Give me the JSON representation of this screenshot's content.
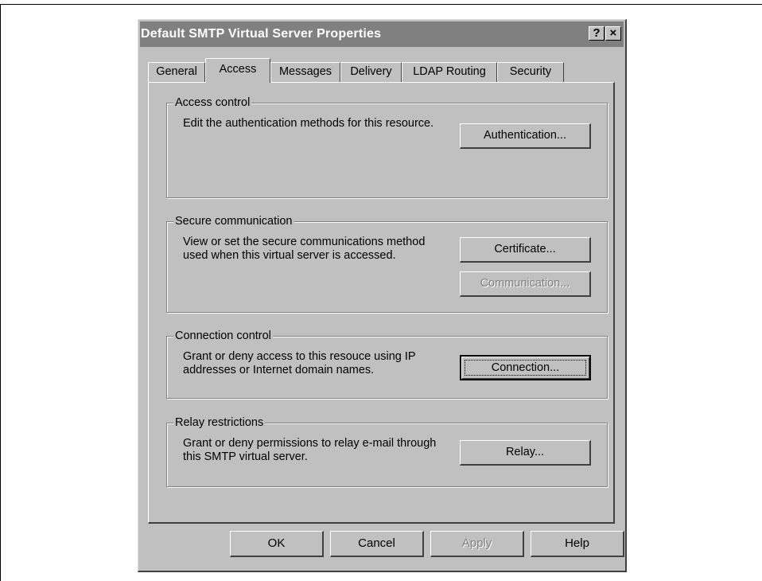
{
  "window": {
    "title": "Default SMTP Virtual Server Properties",
    "help_button": "?",
    "close_button": "×"
  },
  "tabs": [
    {
      "label": "General",
      "active": false
    },
    {
      "label": "Access",
      "active": true
    },
    {
      "label": "Messages",
      "active": false
    },
    {
      "label": "Delivery",
      "active": false
    },
    {
      "label": "LDAP Routing",
      "active": false
    },
    {
      "label": "Security",
      "active": false
    }
  ],
  "groups": {
    "access_control": {
      "label": "Access control",
      "text": "Edit the authentication methods for this resource.",
      "button": "Authentication..."
    },
    "secure_communication": {
      "label": "Secure communication",
      "text": "View or set the secure communications method used when this virtual server is accessed.",
      "button_certificate": "Certificate...",
      "button_communication": "Communication..."
    },
    "connection_control": {
      "label": "Connection control",
      "text": "Grant or deny access to this resouce using IP addresses or Internet domain names.",
      "button": "Connection..."
    },
    "relay_restrictions": {
      "label": "Relay restrictions",
      "text": "Grant or deny permissions to relay e-mail through this SMTP virtual server.",
      "button": "Relay..."
    }
  },
  "footer": {
    "ok": "OK",
    "cancel": "Cancel",
    "apply": "Apply",
    "help": "Help"
  },
  "colors": {
    "dialog_face": "#c0c0c0",
    "titlebar_inactive": "#808080",
    "disabled_text": "#808080"
  }
}
